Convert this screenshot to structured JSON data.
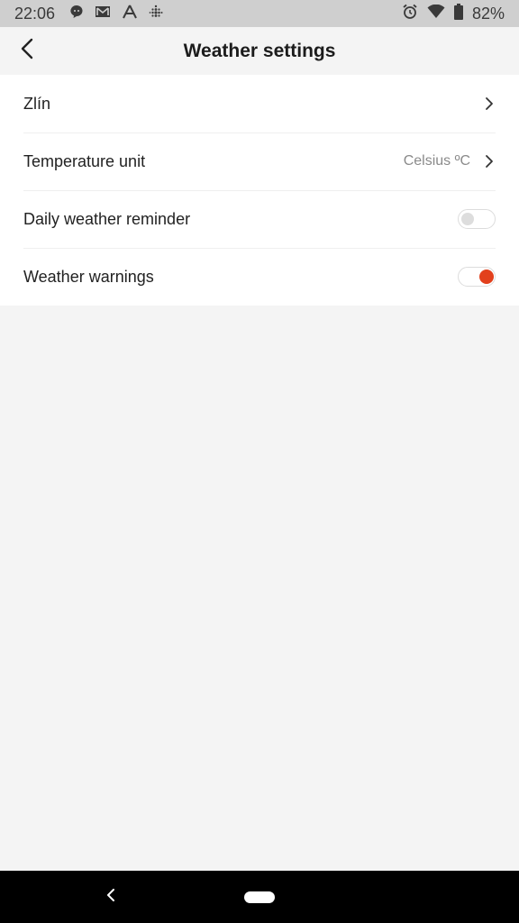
{
  "status_bar": {
    "time": "22:06",
    "battery_percent": "82%",
    "left_icons": [
      "chat-icon",
      "gmail-icon",
      "nav-arrow-icon",
      "fitbit-icon"
    ],
    "right_icons": [
      "alarm-icon",
      "wifi-icon",
      "battery-icon"
    ]
  },
  "header": {
    "title": "Weather settings",
    "back_icon": "back-arrow-icon"
  },
  "settings": [
    {
      "label": "Zlín",
      "value": "",
      "control": "chevron"
    },
    {
      "label": "Temperature unit",
      "value": "Celsius ºC",
      "control": "chevron"
    },
    {
      "label": "Daily weather reminder",
      "control": "toggle",
      "enabled": false
    },
    {
      "label": "Weather warnings",
      "control": "toggle",
      "enabled": true
    }
  ],
  "colors": {
    "accent": "#e2401c",
    "background": "#f4f4f4",
    "status_bar": "#cfcfcf"
  },
  "nav_bar": {
    "icons": [
      "back-icon",
      "home-pill-icon"
    ]
  }
}
